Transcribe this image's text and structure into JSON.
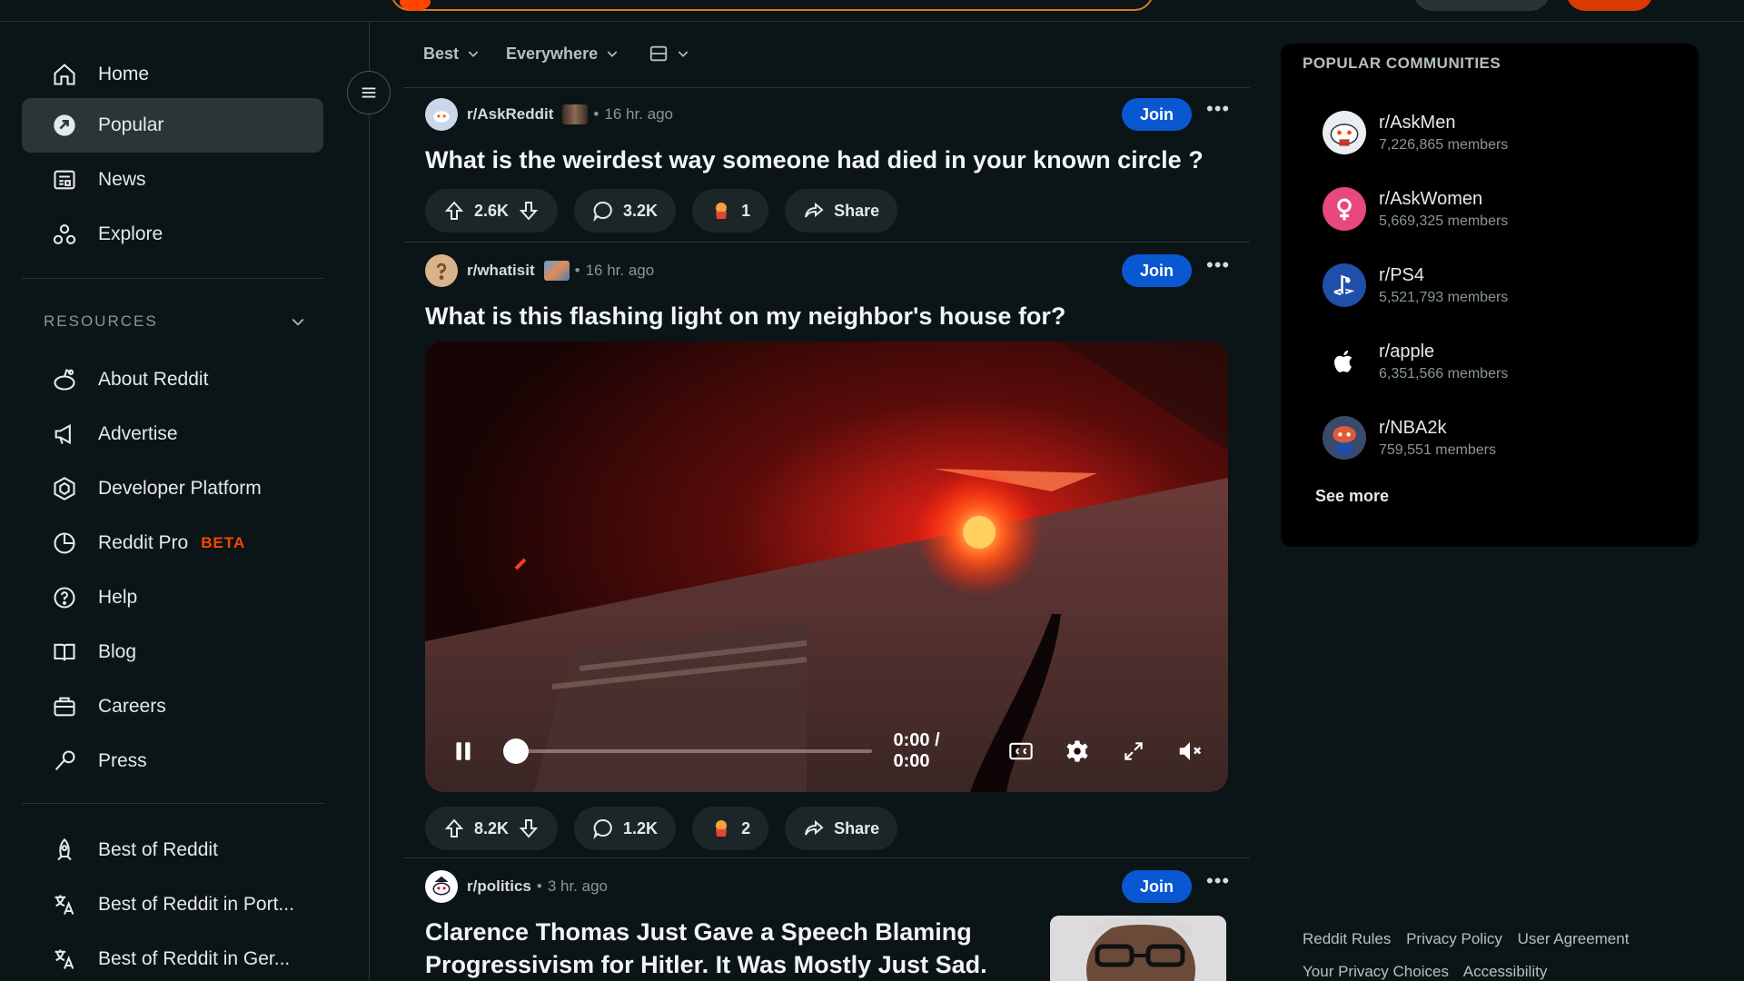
{
  "nav": {
    "home": "Home",
    "popular": "Popular",
    "news": "News",
    "explore": "Explore",
    "resources_heading": "RESOURCES",
    "about": "About Reddit",
    "advertise": "Advertise",
    "developer": "Developer Platform",
    "pro": "Reddit Pro",
    "pro_badge": "BETA",
    "help": "Help",
    "blog": "Blog",
    "careers": "Careers",
    "press": "Press",
    "best": "Best of Reddit",
    "best_port": "Best of Reddit in Port...",
    "best_ger": "Best of Reddit in Ger..."
  },
  "sort": {
    "order": "Best",
    "scope": "Everywhere"
  },
  "posts": [
    {
      "subreddit": "r/AskReddit",
      "time": "16 hr. ago",
      "join": "Join",
      "title": "What is the weirdest way someone had died in your known circle ?",
      "votes": "2.6K",
      "comments": "3.2K",
      "awards": "1",
      "share": "Share"
    },
    {
      "subreddit": "r/whatisit",
      "time": "16 hr. ago",
      "join": "Join",
      "title": "What is this flashing light on my neighbor's house for?",
      "votes": "8.2K",
      "comments": "1.2K",
      "awards": "2",
      "share": "Share",
      "video_time": "0:00 / 0:00",
      "video_progress": 0
    },
    {
      "subreddit": "r/politics",
      "time": "3 hr. ago",
      "join": "Join",
      "title_line1": "Clarence Thomas Just Gave a Speech Blaming",
      "title_line2": "Progressivism for Hitler. It Was Mostly Just Sad."
    }
  ],
  "popular": {
    "title": "POPULAR COMMUNITIES",
    "items": [
      {
        "name": "r/AskMen",
        "members": "7,226,865 members"
      },
      {
        "name": "r/AskWomen",
        "members": "5,669,325 members"
      },
      {
        "name": "r/PS4",
        "members": "5,521,793 members"
      },
      {
        "name": "r/apple",
        "members": "6,351,566 members"
      },
      {
        "name": "r/NBA2k",
        "members": "759,551 members"
      }
    ],
    "see_more": "See more"
  },
  "footer": {
    "rules": "Reddit Rules",
    "privacy": "Privacy Policy",
    "agreement": "User Agreement",
    "choices": "Your Privacy Choices",
    "accessibility": "Accessibility"
  },
  "colors": {
    "background": "#0b1416",
    "join_button": "#0a57d2",
    "beta": "#ff4500",
    "search_border": "#d77a1f"
  }
}
